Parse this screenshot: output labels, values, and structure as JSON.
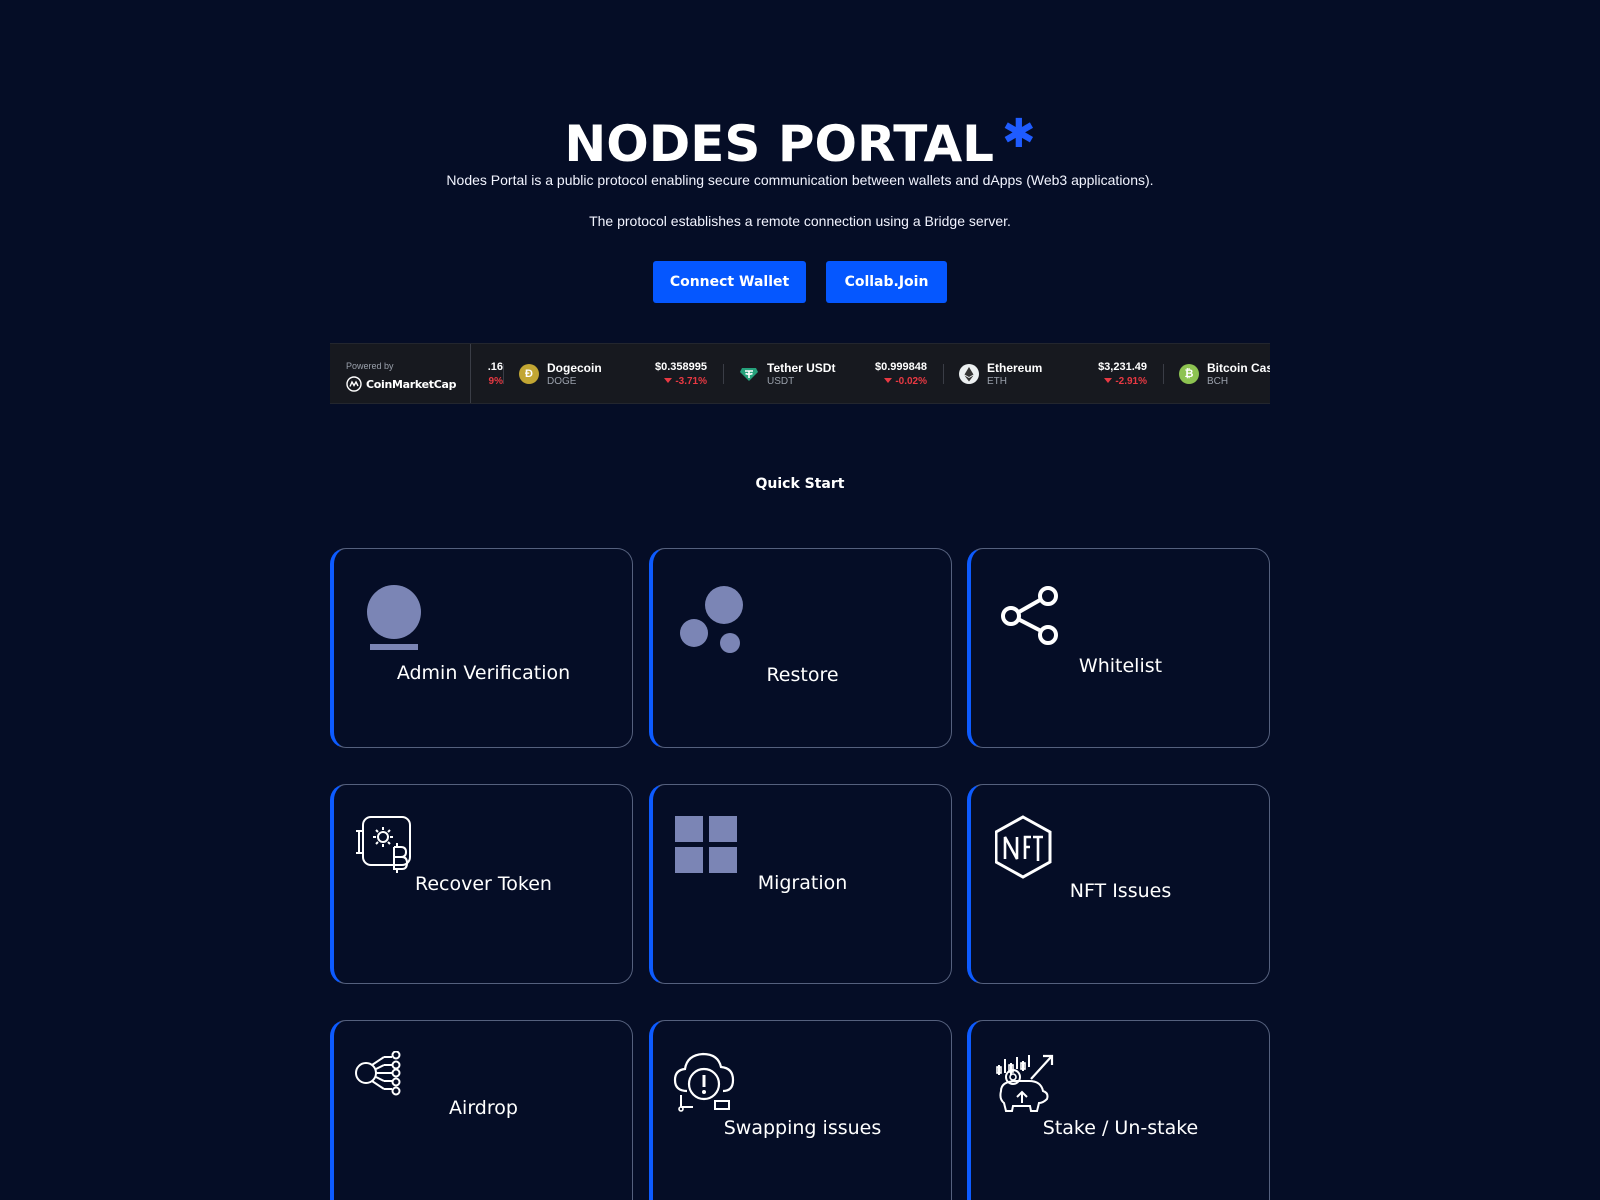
{
  "header": {
    "title": "NODES PORTAL",
    "title_mark": "✱",
    "description_1": "Nodes Portal is a public protocol enabling secure communication between wallets and dApps (Web3 applications).",
    "description_2": "The protocol establishes a remote connection using a Bridge server."
  },
  "actions": {
    "connect_label": "Connect Wallet",
    "collab_label": "Collab.Join"
  },
  "ticker": {
    "powered_by": "Powered by",
    "provider": "CoinMarketCap",
    "partial": {
      "price": ".16",
      "change": "9%"
    },
    "coins": [
      {
        "name": "Dogecoin",
        "symbol": "DOGE",
        "price": "$0.358995",
        "change": "-3.71%",
        "icon": "doge-icon",
        "color": "#c2a633"
      },
      {
        "name": "Tether USDt",
        "symbol": "USDT",
        "price": "$0.999848",
        "change": "-0.02%",
        "icon": "tether-icon",
        "color": "#26a17b"
      },
      {
        "name": "Ethereum",
        "symbol": "ETH",
        "price": "$3,231.49",
        "change": "-2.91%",
        "icon": "ethereum-icon",
        "color": "#ecf0f1"
      },
      {
        "name": "Bitcoin Cash",
        "symbol": "BCH",
        "price": "",
        "change": "",
        "icon": "bitcoin-cash-icon",
        "color": "#8dc351"
      }
    ]
  },
  "quick_start": {
    "title": "Quick Start",
    "cards": [
      {
        "label": "Admin Verification",
        "icon": "user-icon"
      },
      {
        "label": "Restore",
        "icon": "bubbles-icon"
      },
      {
        "label": "Whitelist",
        "icon": "share-icon"
      },
      {
        "label": "Recover Token",
        "icon": "crypto-bitcoin-icon"
      },
      {
        "label": "Migration",
        "icon": "grid-icon"
      },
      {
        "label": "NFT Issues",
        "icon": "nft-icon"
      },
      {
        "label": "Airdrop",
        "icon": "network-icon"
      },
      {
        "label": "Swapping issues",
        "icon": "cloud-alert-icon"
      },
      {
        "label": "Stake / Un-stake",
        "icon": "piggy-bank-icon"
      }
    ]
  },
  "colors": {
    "background": "#050d26",
    "accent": "#0557ff",
    "negative": "#ea3943"
  }
}
